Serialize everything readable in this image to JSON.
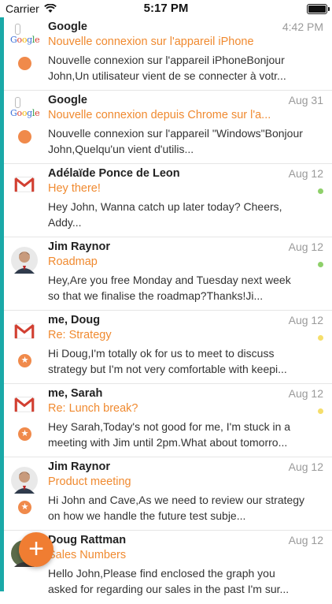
{
  "status": {
    "carrier": "Carrier",
    "time": "5:17 PM"
  },
  "emails": [
    {
      "sender": "Google",
      "date": "4:42 PM",
      "subject": "Nouvelle connexion sur l'appareil iPhone",
      "preview": "Nouvelle connexion sur l'appareil iPhoneBonjour John,Un utilisateur vient de se connecter à votr..."
    },
    {
      "sender": "Google",
      "date": "Aug 31",
      "subject": "Nouvelle connexion depuis Chrome sur l'a...",
      "preview": "Nouvelle connexion sur l'appareil \"Windows\"Bonjour John,Quelqu'un vient d'utilis..."
    },
    {
      "sender": "Adélaïde Ponce de Leon",
      "date": "Aug 12",
      "subject": "Hey there!",
      "preview": "Hey John,  Wanna catch up later today?  Cheers, Addy..."
    },
    {
      "sender": "Jim Raynor",
      "date": "Aug 12",
      "subject": "Roadmap",
      "preview": "Hey,Are you free Monday and Tuesday next week so that we finalise the roadmap?Thanks!Ji..."
    },
    {
      "sender": "me, Doug",
      "date": "Aug 12",
      "subject": "Re: Strategy",
      "preview": "Hi Doug,I'm totally ok for us to meet to discuss strategy but I'm not very comfortable with keepi..."
    },
    {
      "sender": "me, Sarah",
      "date": "Aug 12",
      "subject": "Re: Lunch break?",
      "preview": "Hey Sarah,Today's not good for me, I'm stuck in a meeting with Jim until 2pm.What about tomorro..."
    },
    {
      "sender": "Jim Raynor",
      "date": "Aug 12",
      "subject": "Product meeting",
      "preview": "Hi John and Cave,As we need to review our strategy on how we handle the future test subje..."
    },
    {
      "sender": "Doug Rattman",
      "date": "Aug 12",
      "subject": "Sales Numbers",
      "preview": "Hello John,Please find enclosed the graph you asked for regarding our sales in the past I'm sur..."
    }
  ],
  "logo_text": {
    "google": "Google"
  },
  "icons": {
    "compose": "plus-icon",
    "star": "star-icon"
  },
  "colors": {
    "accent": "#1aa9a8",
    "subject": "#f08a30",
    "fab": "#f07d32",
    "read_dot_green": "#8ed06a",
    "read_dot_yellow": "#f5de6b"
  }
}
